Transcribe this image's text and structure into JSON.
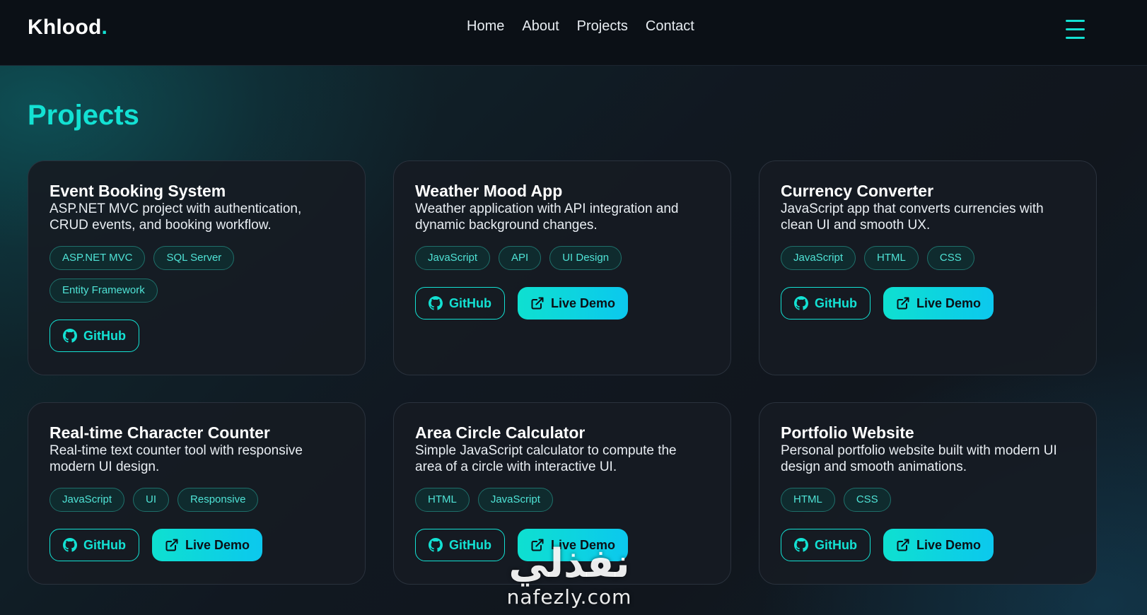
{
  "brand": {
    "name": "Khlood",
    "dot": ".",
    "accent": "#13e1d3"
  },
  "nav": {
    "links": [
      "Home",
      "About",
      "Projects",
      "Contact"
    ],
    "menu_icon": "hamburger-menu-icon"
  },
  "section": {
    "title": "Projects"
  },
  "labels": {
    "github": "GitHub",
    "live_demo": "Live Demo"
  },
  "projects": [
    {
      "title": "Event Booking System",
      "description": "ASP.NET MVC project with authentication, CRUD events, and booking workflow.",
      "tags": [
        "ASP.NET MVC",
        "SQL Server",
        "Entity Framework"
      ],
      "has_live_demo": false
    },
    {
      "title": "Weather Mood App",
      "description": "Weather application with API integration and dynamic background changes.",
      "tags": [
        "JavaScript",
        "API",
        "UI Design"
      ],
      "has_live_demo": true
    },
    {
      "title": "Currency Converter",
      "description": "JavaScript app that converts currencies with clean UI and smooth UX.",
      "tags": [
        "JavaScript",
        "HTML",
        "CSS"
      ],
      "has_live_demo": true
    },
    {
      "title": "Real-time Character Counter",
      "description": "Real-time text counter tool with responsive modern UI design.",
      "tags": [
        "JavaScript",
        "UI",
        "Responsive"
      ],
      "has_live_demo": true
    },
    {
      "title": "Area Circle Calculator",
      "description": "Simple JavaScript calculator to compute the area of a circle with interactive UI.",
      "tags": [
        "HTML",
        "JavaScript"
      ],
      "has_live_demo": true
    },
    {
      "title": "Portfolio Website",
      "description": "Personal portfolio website built with modern UI design and smooth animations.",
      "tags": [
        "HTML",
        "CSS"
      ],
      "has_live_demo": true
    }
  ],
  "watermark": {
    "arabic": "نفذلي",
    "latin": "nafezly.com"
  },
  "icons": {
    "github": "github-icon",
    "external": "external-link-icon"
  }
}
